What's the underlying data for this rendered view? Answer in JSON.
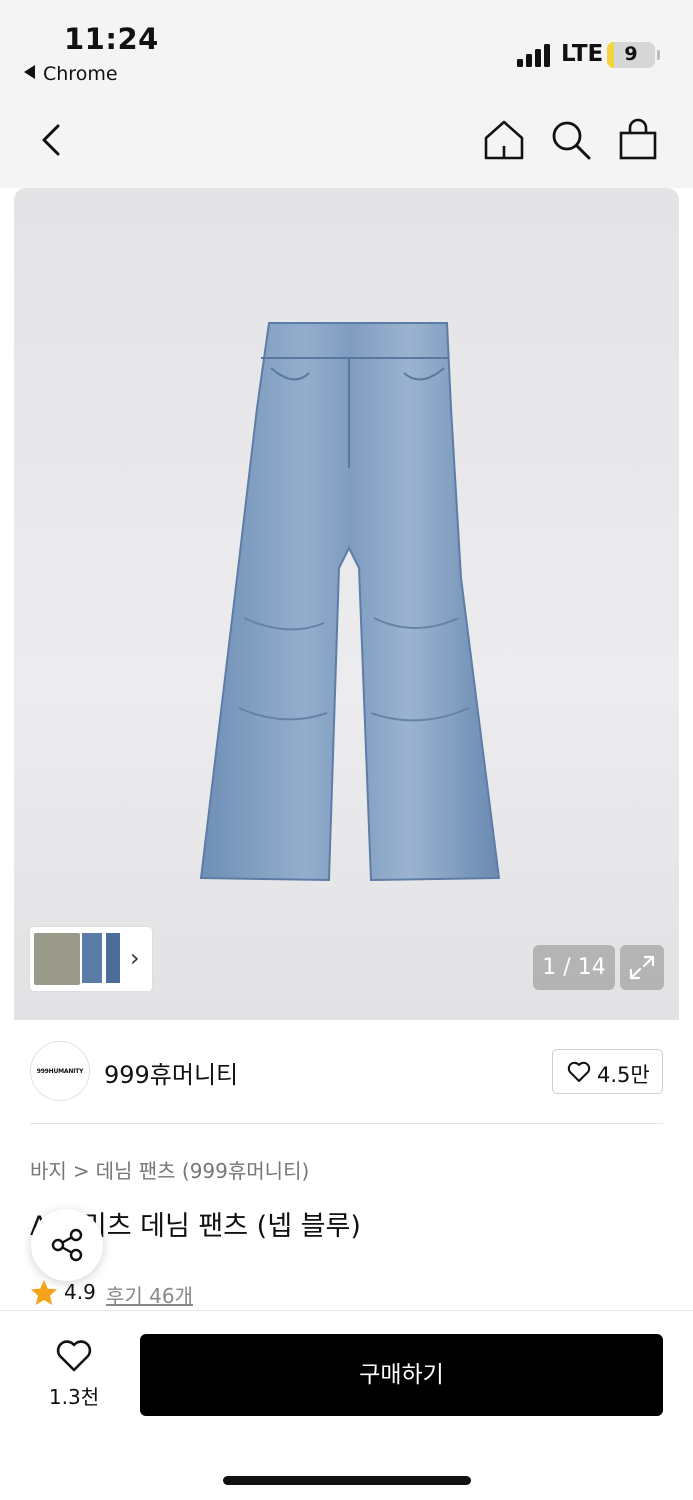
{
  "status_bar": {
    "time": "11:24",
    "back_app": "Chrome",
    "network": "LTE",
    "battery_level": "9",
    "battery_fraction": 0.09
  },
  "nav": {
    "icons": [
      "back-icon",
      "home-icon",
      "search-icon",
      "bag-icon"
    ]
  },
  "gallery": {
    "counter": "1 / 14",
    "thumb_arrow": "›"
  },
  "brand": {
    "logo_text": "999HUMANITY",
    "name": "999휴머니티",
    "likes": "4.5만"
  },
  "product": {
    "breadcrumb": [
      "바지",
      "데님 팬츠 (999휴머니티)"
    ],
    "breadcrumb_sep": ">",
    "title": "A 플리츠 데님 팬츠 (넵 블루)",
    "rating": "4.9",
    "reviews": "후기 46개",
    "rating_color": "#f7a21b"
  },
  "bottom_bar": {
    "wish_count": "1.3천",
    "buy_label": "구매하기",
    "buy_color": "#000000"
  }
}
